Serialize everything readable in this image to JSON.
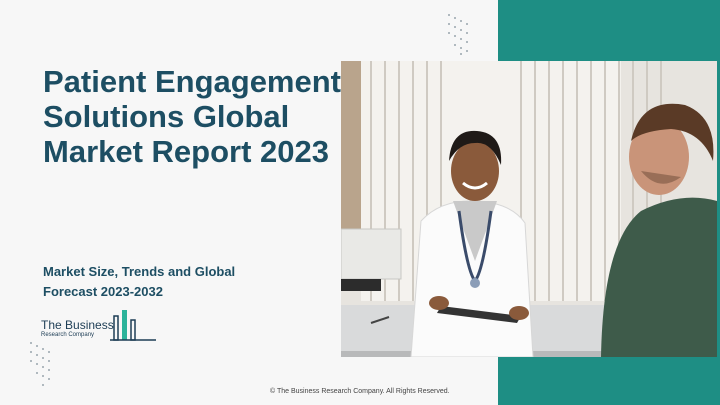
{
  "title": "Patient Engagement Solutions Global Market Report 2023",
  "subtitle": "Market Size, Trends and Global Forecast 2023-2032",
  "logo": {
    "line1": "The Business",
    "line2": "Research Company"
  },
  "photo": {
    "description_icon": "doctor-patient-photo"
  },
  "footer": "© The Business Research Company. All Rights Reserved.",
  "colors": {
    "teal": "#1e8e84",
    "title": "#1d4e63",
    "logo_green": "#2bb39a"
  }
}
